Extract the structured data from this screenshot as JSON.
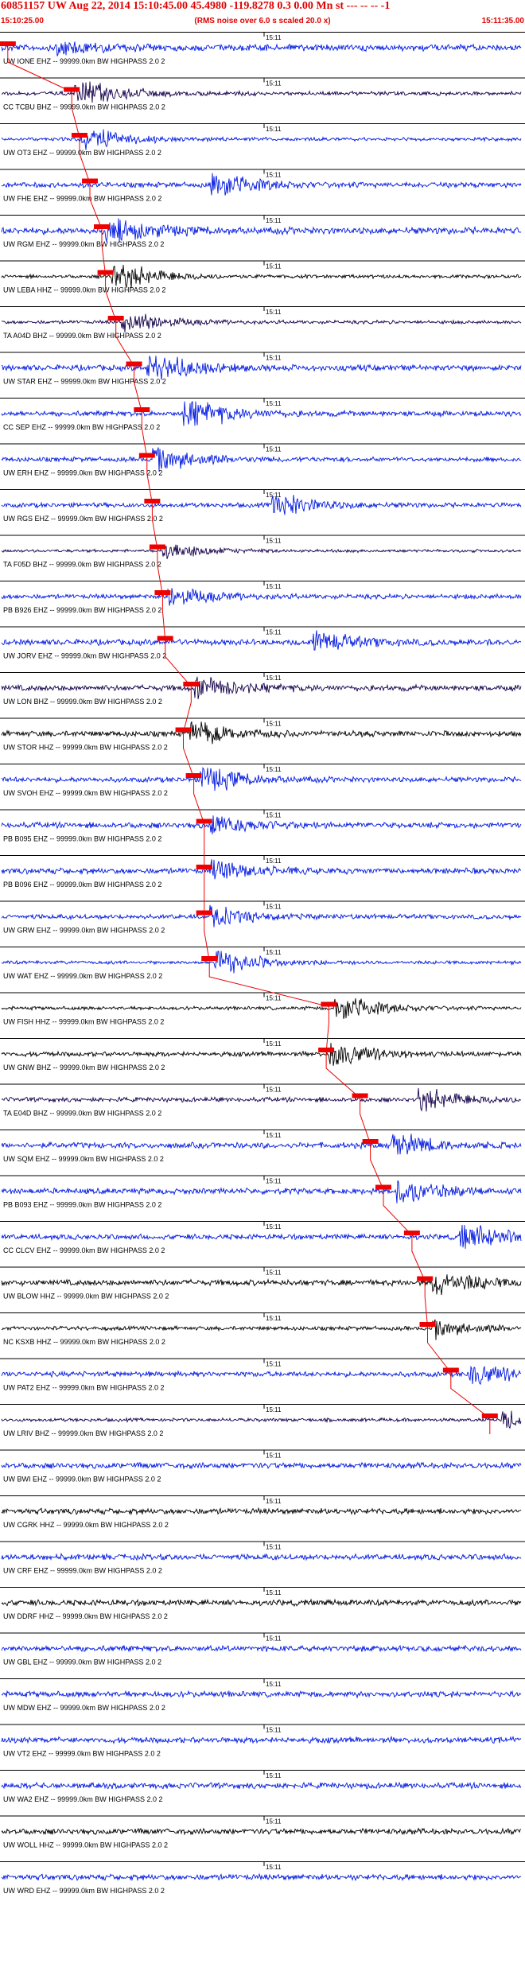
{
  "header": {
    "title": "60851157 UW Aug 22, 2014 15:10:45.00   45.4980 -119.8278  0.3 0.00 Mn st --- -- --  -1",
    "subtitle": "(RMS noise over 6.0 s scaled 20.0 x)",
    "start_time": "15:10:25.00",
    "end_time": "15:11:35.00"
  },
  "minute_label": "15:11",
  "colors": {
    "header_text": "#e00000",
    "pick_marker": "#ee0000",
    "trace_blue": "#0018e0",
    "trace_dark": "#14004a",
    "trace_black": "#000000"
  },
  "traces": [
    {
      "label": "UW IONE EHZ -- 99999.0km BW  HIGHPASS  2.0  2",
      "color": "blue",
      "amp": 0.55,
      "pick": 0.012,
      "burst": 0.1,
      "burst_amp": 1.6
    },
    {
      "label": "CC TCBU BHZ -- 99999.0km BW  HIGHPASS  2.0  2",
      "color": "dark",
      "amp": 0.35,
      "pick": 0.135,
      "burst": 0.14,
      "burst_amp": 3.0
    },
    {
      "label": "UW OT3 EHZ -- 99999.0km BW  HIGHPASS  2.0  2",
      "color": "blue",
      "amp": 0.3,
      "pick": 0.15,
      "burst": 0.15,
      "burst_amp": 2.5
    },
    {
      "label": "UW FHE EHZ -- 99999.0km BW  HIGHPASS  2.0  2",
      "color": "blue",
      "amp": 0.45,
      "pick": 0.17,
      "burst": 0.4,
      "burst_amp": 2.8
    },
    {
      "label": "UW RGM EHZ -- 99999.0km BW  HIGHPASS  2.0  2",
      "color": "blue",
      "amp": 0.6,
      "pick": 0.193,
      "burst": 0.2,
      "burst_amp": 2.6
    },
    {
      "label": "UW LEBA HHZ -- 99999.0km BW  HIGHPASS  2.0  2",
      "color": "black",
      "amp": 0.3,
      "pick": 0.2,
      "burst": 0.21,
      "burst_amp": 3.2
    },
    {
      "label": "TA A04D BHZ -- 99999.0km BW  HIGHPASS  2.0  2",
      "color": "dark",
      "amp": 0.3,
      "pick": 0.22,
      "burst": 0.23,
      "burst_amp": 2.4
    },
    {
      "label": "UW STAR EHZ -- 99999.0km BW  HIGHPASS  2.0  2",
      "color": "blue",
      "amp": 0.5,
      "pick": 0.255,
      "burst": 0.28,
      "burst_amp": 3.0
    },
    {
      "label": "CC SEP EHZ -- 99999.0km BW  HIGHPASS  2.0  2",
      "color": "blue",
      "amp": 0.45,
      "pick": 0.27,
      "burst": 0.35,
      "burst_amp": 3.2
    },
    {
      "label": "UW ERH EHZ -- 99999.0km BW  HIGHPASS  2.0  2",
      "color": "blue",
      "amp": 0.4,
      "pick": 0.28,
      "burst": 0.29,
      "burst_amp": 2.6
    },
    {
      "label": "UW RGS EHZ -- 99999.0km BW  HIGHPASS  2.0  2",
      "color": "blue",
      "amp": 0.4,
      "pick": 0.29,
      "burst": 0.52,
      "burst_amp": 2.4
    },
    {
      "label": "TA F05D BHZ -- 99999.0km BW  HIGHPASS  2.0  2",
      "color": "dark",
      "amp": 0.25,
      "pick": 0.3,
      "burst": 0.31,
      "burst_amp": 1.8
    },
    {
      "label": "PB B926 EHZ -- 99999.0km BW  HIGHPASS  2.0  2",
      "color": "blue",
      "amp": 0.4,
      "pick": 0.31,
      "burst": 0.32,
      "burst_amp": 2.0
    },
    {
      "label": "UW JORV EHZ -- 99999.0km BW  HIGHPASS  2.0  2",
      "color": "blue",
      "amp": 0.5,
      "pick": 0.315,
      "burst": 0.6,
      "burst_amp": 2.0
    },
    {
      "label": "UW LON BHZ -- 99999.0km BW  HIGHPASS  2.0  2",
      "color": "dark",
      "amp": 0.5,
      "pick": 0.365,
      "burst": 0.37,
      "burst_amp": 2.2
    },
    {
      "label": "UW STOR HHZ -- 99999.0km BW  HIGHPASS  2.0  2",
      "color": "black",
      "amp": 0.5,
      "pick": 0.35,
      "burst": 0.36,
      "burst_amp": 2.4
    },
    {
      "label": "UW SVOH EHZ -- 99999.0km BW  HIGHPASS  2.0  2",
      "color": "blue",
      "amp": 0.45,
      "pick": 0.37,
      "burst": 0.38,
      "burst_amp": 2.6
    },
    {
      "label": "PB B095 EHZ -- 99999.0km BW  HIGHPASS  2.0  2",
      "color": "blue",
      "amp": 0.5,
      "pick": 0.39,
      "burst": 0.4,
      "burst_amp": 2.0
    },
    {
      "label": "PB B096 EHZ -- 99999.0km BW  HIGHPASS  2.0  2",
      "color": "blue",
      "amp": 0.5,
      "pick": 0.39,
      "burst": 0.4,
      "burst_amp": 2.0
    },
    {
      "label": "UW GRW EHZ -- 99999.0km BW  HIGHPASS  2.0  2",
      "color": "blue",
      "amp": 0.4,
      "pick": 0.39,
      "burst": 0.4,
      "burst_amp": 1.8
    },
    {
      "label": "UW WAT EHZ -- 99999.0km BW  HIGHPASS  2.0  2",
      "color": "blue",
      "amp": 0.3,
      "pick": 0.4,
      "burst": 0.41,
      "burst_amp": 2.6
    },
    {
      "label": "UW FISH HHZ -- 99999.0km BW  HIGHPASS  2.0  2",
      "color": "black",
      "amp": 0.3,
      "pick": 0.63,
      "burst": 0.64,
      "burst_amp": 3.0
    },
    {
      "label": "UW GNW BHZ -- 99999.0km BW  HIGHPASS  2.0  2",
      "color": "black",
      "amp": 0.4,
      "pick": 0.625,
      "burst": 0.63,
      "burst_amp": 2.6
    },
    {
      "label": "TA E04D BHZ -- 99999.0km BW  HIGHPASS  2.0  2",
      "color": "dark",
      "amp": 0.4,
      "pick": 0.69,
      "burst": 0.8,
      "burst_amp": 2.4
    },
    {
      "label": "UW SQM EHZ -- 99999.0km BW  HIGHPASS  2.0  2",
      "color": "blue",
      "amp": 0.5,
      "pick": 0.71,
      "burst": 0.75,
      "burst_amp": 2.2
    },
    {
      "label": "PB B093 EHZ -- 99999.0km BW  HIGHPASS  2.0  2",
      "color": "blue",
      "amp": 0.5,
      "pick": 0.735,
      "burst": 0.76,
      "burst_amp": 2.4
    },
    {
      "label": "CC CLCV EHZ -- 99999.0km BW  HIGHPASS  2.0  2",
      "color": "blue",
      "amp": 0.45,
      "pick": 0.79,
      "burst": 0.88,
      "burst_amp": 3.2
    },
    {
      "label": "UW BLOW HHZ -- 99999.0km BW  HIGHPASS  2.0  2",
      "color": "black",
      "amp": 0.5,
      "pick": 0.815,
      "burst": 0.83,
      "burst_amp": 2.6
    },
    {
      "label": "NC KSXB HHZ -- 99999.0km BW  HIGHPASS  2.0  2",
      "color": "black",
      "amp": 0.35,
      "pick": 0.82,
      "burst": 0.83,
      "burst_amp": 1.6
    },
    {
      "label": "UW PAT2 EHZ -- 99999.0km BW  HIGHPASS  2.0  2",
      "color": "blue",
      "amp": 0.45,
      "pick": 0.865,
      "burst": 0.9,
      "burst_amp": 2.2
    },
    {
      "label": "UW LRIV BHZ -- 99999.0km BW  HIGHPASS  2.0  2",
      "color": "dark",
      "amp": 0.3,
      "pick": 0.94,
      "burst": 0.96,
      "burst_amp": 1.6
    },
    {
      "label": "UW BWI EHZ -- 99999.0km BW  HIGHPASS  2.0  2",
      "color": "blue",
      "amp": 0.5,
      "pick": null,
      "burst": null,
      "burst_amp": 0
    },
    {
      "label": "UW CGRK HHZ -- 99999.0km BW  HIGHPASS  2.0  2",
      "color": "black",
      "amp": 0.5,
      "pick": null,
      "burst": null,
      "burst_amp": 0
    },
    {
      "label": "UW CRF EHZ -- 99999.0km BW  HIGHPASS  2.0  2",
      "color": "blue",
      "amp": 0.5,
      "pick": null,
      "burst": null,
      "burst_amp": 0
    },
    {
      "label": "UW DDRF HHZ -- 99999.0km BW  HIGHPASS  2.0  2",
      "color": "black",
      "amp": 0.5,
      "pick": null,
      "burst": null,
      "burst_amp": 0
    },
    {
      "label": "UW GBL EHZ -- 99999.0km BW  HIGHPASS  2.0  2",
      "color": "blue",
      "amp": 0.5,
      "pick": null,
      "burst": null,
      "burst_amp": 0
    },
    {
      "label": "UW MDW EHZ -- 99999.0km BW  HIGHPASS  2.0  2",
      "color": "blue",
      "amp": 0.5,
      "pick": null,
      "burst": null,
      "burst_amp": 0
    },
    {
      "label": "UW VT2 EHZ -- 99999.0km BW  HIGHPASS  2.0  2",
      "color": "blue",
      "amp": 0.5,
      "pick": null,
      "burst": null,
      "burst_amp": 0
    },
    {
      "label": "UW WA2 EHZ -- 99999.0km BW  HIGHPASS  2.0  2",
      "color": "blue",
      "amp": 0.5,
      "pick": null,
      "burst": null,
      "burst_amp": 0
    },
    {
      "label": "UW WOLL HHZ -- 99999.0km BW  HIGHPASS  2.0  2",
      "color": "black",
      "amp": 0.5,
      "pick": null,
      "burst": null,
      "burst_amp": 0
    },
    {
      "label": "UW WRD EHZ -- 99999.0km BW  HIGHPASS  2.0  2",
      "color": "blue",
      "amp": 0.5,
      "pick": null,
      "burst": null,
      "burst_amp": 0
    }
  ]
}
